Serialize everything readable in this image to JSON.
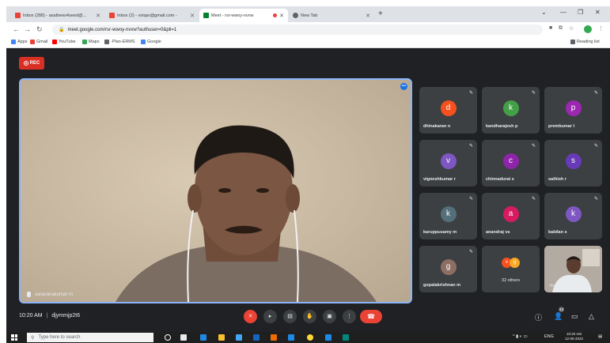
{
  "browser": {
    "tabs": [
      {
        "title": "Inbox (288) - asathees4seed@...",
        "favicon_color": "#ea4335",
        "active": false
      },
      {
        "title": "Inbox (2) - voiqar@gmail.com -",
        "favicon_color": "#ea4335",
        "active": false
      },
      {
        "title": "Meet - rsr-wwoy-nvvw",
        "favicon_color": "#00832d",
        "active": true,
        "recording_dot_color": "#ea4335"
      },
      {
        "title": "New Tab",
        "favicon_color": "#5f6368",
        "active": false
      }
    ],
    "new_tab_label": "+",
    "url": "meet.google.com/rsr-wwoy-nvvw?authuser=0&pli=1",
    "bookmarks": [
      {
        "label": "Apps",
        "color": "#4285f4"
      },
      {
        "label": "Gmail",
        "color": "#ea4335"
      },
      {
        "label": "YouTube",
        "color": "#ff0000"
      },
      {
        "label": "Maps",
        "color": "#34a853"
      },
      {
        "label": "-Plan-ERMS",
        "color": "#5f6368"
      },
      {
        "label": "Google",
        "color": "#4285f4"
      }
    ],
    "reading_list": "Reading list"
  },
  "meet": {
    "rec_label": "REC",
    "main_speaker_name": "saravanakumar m",
    "participants": [
      {
        "name": "dhinakaran n",
        "initial": "d",
        "color": "#f4511e"
      },
      {
        "name": "kandharajesh p",
        "initial": "k",
        "color": "#43a047"
      },
      {
        "name": "premkumar l",
        "initial": "p",
        "color": "#9c27b0"
      },
      {
        "name": "vigneshkumar r",
        "initial": "v",
        "color": "#7e57c2"
      },
      {
        "name": "chinnadurai s",
        "initial": "c",
        "color": "#8e24aa"
      },
      {
        "name": "sathish r",
        "initial": "s",
        "color": "#673ab7"
      },
      {
        "name": "karuppusamy m",
        "initial": "k",
        "color": "#546e7a"
      },
      {
        "name": "anandraj vs",
        "initial": "a",
        "color": "#d81b60"
      },
      {
        "name": "kabilan s",
        "initial": "k",
        "color": "#7e57c2"
      },
      {
        "name": "gopalakrishnan m",
        "initial": "g",
        "color": "#8d6e63"
      }
    ],
    "others_label": "32 others",
    "self_label": "You",
    "time": "10:20 AM",
    "divider": "|",
    "meeting_code": "djymmjp2t6",
    "participants_badge": "43"
  },
  "taskbar": {
    "search_placeholder": "Type here to search",
    "lang": "ENG",
    "clock_time": "10:20 AM",
    "clock_date": "12-05-2022"
  }
}
